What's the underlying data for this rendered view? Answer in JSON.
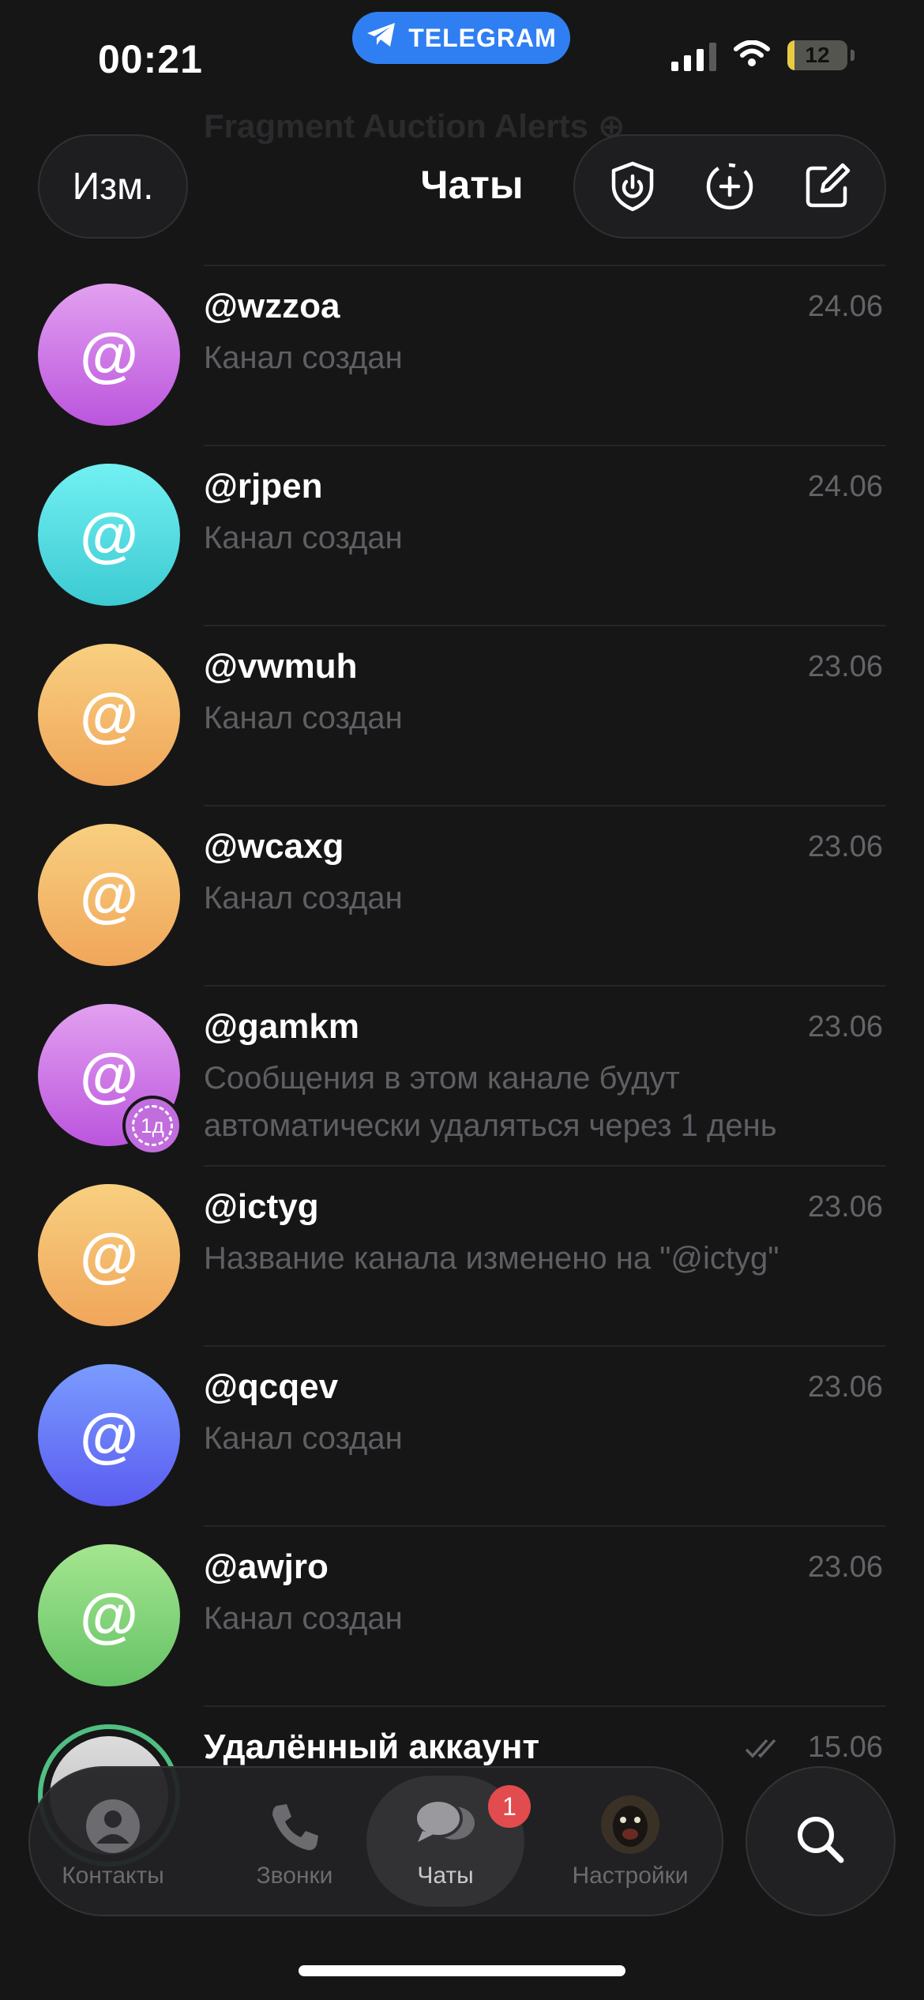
{
  "status_bar": {
    "time": "00:21",
    "app_pill": "TELEGRAM",
    "battery": "12",
    "battery_fraction": 0.12
  },
  "header": {
    "edit_label": "Изм.",
    "title": "Чаты",
    "behind_preview": "Fragment Auction Alerts ⊕"
  },
  "chats": [
    {
      "name": "@wzzoa",
      "date": "24.06",
      "preview": "Канал создан",
      "avatar_text": "@",
      "avatar_colors": [
        "#e2a0f0",
        "#bb55dd"
      ]
    },
    {
      "name": "@rjpen",
      "date": "24.06",
      "preview": "Канал создан",
      "avatar_text": "@",
      "avatar_colors": [
        "#72f0f2",
        "#3ccad2"
      ]
    },
    {
      "name": "@vwmuh",
      "date": "23.06",
      "preview": "Канал создан",
      "avatar_text": "@",
      "avatar_colors": [
        "#f8cf80",
        "#f0a65a"
      ]
    },
    {
      "name": "@wcaxg",
      "date": "23.06",
      "preview": "Канал создан",
      "avatar_text": "@",
      "avatar_colors": [
        "#f8cf80",
        "#f0a65a"
      ]
    },
    {
      "name": "@gamkm",
      "date": "23.06",
      "preview": "Сообщения в этом канале будут автоматически удаляться через 1 день",
      "avatar_text": "@",
      "avatar_colors": [
        "#e2a0f0",
        "#bb55dd"
      ],
      "timer_label": "1д"
    },
    {
      "name": "@ictyg",
      "date": "23.06",
      "preview": "Название канала изменено на \"@ictyg\"",
      "avatar_text": "@",
      "avatar_colors": [
        "#f8cf80",
        "#f0a65a"
      ]
    },
    {
      "name": "@qcqev",
      "date": "23.06",
      "preview": "Канал создан",
      "avatar_text": "@",
      "avatar_colors": [
        "#7a9cff",
        "#5a5cf0"
      ]
    },
    {
      "name": "@awjro",
      "date": "23.06",
      "preview": "Канал создан",
      "avatar_text": "@",
      "avatar_colors": [
        "#a4e690",
        "#66c266"
      ]
    },
    {
      "name": "Удалённый аккаунт",
      "date": "15.06",
      "preview": "",
      "avatar_text": "",
      "avatar_colors": [
        "#dcdcdc",
        "#b8b8b8"
      ]
    }
  ],
  "tabs": [
    {
      "label": "Контакты"
    },
    {
      "label": "Звонки"
    },
    {
      "label": "Чаты",
      "badge": "1"
    },
    {
      "label": "Настройки"
    }
  ],
  "colors": {
    "accent": "#2f7ff2",
    "badge": "#e24c4f",
    "background": "#161617"
  }
}
